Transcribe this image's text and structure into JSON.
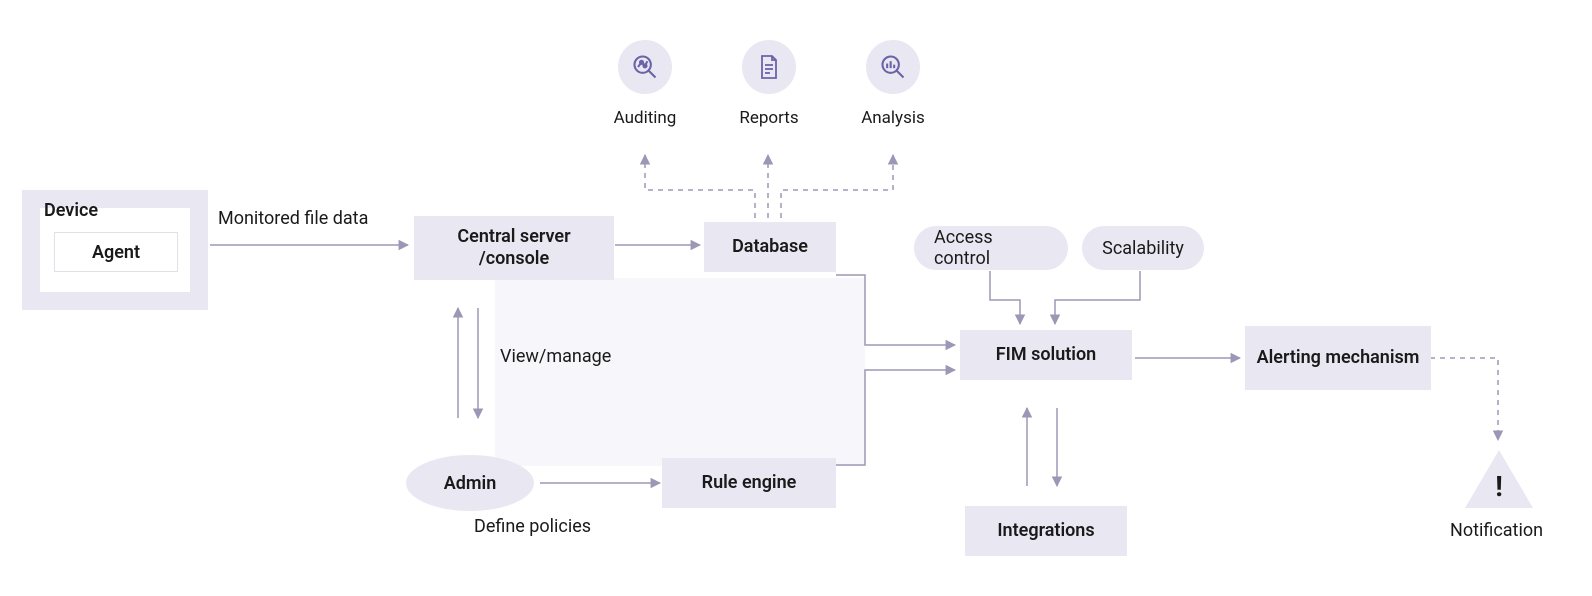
{
  "nodes": {
    "device": "Device",
    "agent": "Agent",
    "central": "Central server /console",
    "database": "Database",
    "admin": "Admin",
    "ruleEngine": "Rule engine",
    "access": "Access control",
    "scalability": "Scalability",
    "fim": "FIM solution",
    "integrations": "Integrations",
    "alerting": "Alerting mechanism"
  },
  "edgeLabels": {
    "monitored": "Monitored file data",
    "viewManage": "View/manage",
    "definePolicies": "Define policies",
    "notification": "Notification"
  },
  "iconLabels": {
    "auditing": "Auditing",
    "reports": "Reports",
    "analysis": "Analysis"
  },
  "warning": "!"
}
